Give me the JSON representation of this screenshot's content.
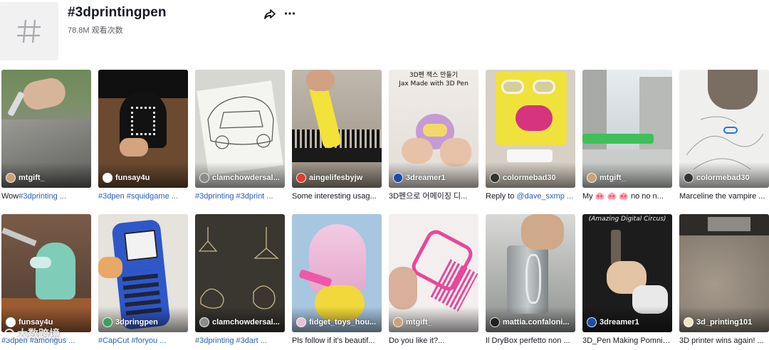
{
  "header": {
    "icon": "hashtag-icon",
    "title": "#3dprintingpen",
    "views": "78.8M 观看次数",
    "share_icon": "share-arrow-icon",
    "more_icon": "more-dots-icon"
  },
  "videos": [
    {
      "author": "mtgift_",
      "caption_plain": "Wow",
      "caption_tags": "#3dprinting ...",
      "avatar_color": "#c9a27a"
    },
    {
      "author": "funsay4u",
      "caption_plain": "",
      "caption_tags": "#3dpen #squidgame ...",
      "avatar_color": "#ffffff"
    },
    {
      "author": "clamchowdersal...",
      "caption_plain": "",
      "caption_tags": "#3dprinting #3dprint ...",
      "avatar_color": "#8c8c8c"
    },
    {
      "author": "aingelifesbyjw",
      "caption_plain": "Some interesting usag...",
      "caption_tags": "",
      "avatar_color": "#d8432e"
    },
    {
      "author": "3dreamer1",
      "caption_plain": "3D펜으로 어메이징 디...",
      "caption_tags": "",
      "avatar_color": "#1f4aa8",
      "overlay": [
        "3D펜 잭스 만들기",
        "Jax Made with 3D Pen"
      ]
    },
    {
      "author": "colormebad30",
      "caption_plain": "Reply to ",
      "caption_tags": "@dave_sxmp ...",
      "avatar_color": "#333333"
    },
    {
      "author": "mtgift_",
      "caption_plain": "My 🐽 🐽 🐽 no no n...",
      "caption_tags": "",
      "avatar_color": "#c9a27a"
    },
    {
      "author": "colormebad30",
      "caption_plain": "Marceline the vampire ...",
      "caption_tags": "",
      "avatar_color": "#333333"
    },
    {
      "author": "funsay4u",
      "caption_plain": "",
      "caption_tags": "#3dpen #amongus ...",
      "avatar_color": "#ffffff"
    },
    {
      "author": "3dpringpen",
      "caption_plain": "",
      "caption_tags": "#CapCut #foryou ...",
      "avatar_color": "#3aa15a"
    },
    {
      "author": "clamchowdersal...",
      "caption_plain": "",
      "caption_tags": "#3dprinting #3dart ...",
      "avatar_color": "#8c8c8c"
    },
    {
      "author": "fidget_toys_hou...",
      "caption_plain": "Pls follow if it's beautif...",
      "caption_tags": "",
      "avatar_color": "#e6c2d6"
    },
    {
      "author": "mtgift_",
      "caption_plain": "Do you like it?...",
      "caption_tags": "",
      "avatar_color": "#c9a27a"
    },
    {
      "author": "mattia.confaloni...",
      "caption_plain": "Il DryBox perfetto non ...",
      "caption_tags": "",
      "avatar_color": "#222222"
    },
    {
      "author": "3dreamer1",
      "caption_plain": "3D_Pen Making Pomni ...",
      "caption_tags": "",
      "avatar_color": "#1f4aa8",
      "overlay": [
        "(Amazing Digital Circus)"
      ]
    },
    {
      "author": "3d_printing101",
      "caption_plain": "3D printer wins again! ...",
      "caption_tags": "",
      "avatar_color": "#f0e4c8"
    }
  ],
  "watermark": {
    "text": "大数跨境",
    "icon": "watermark-logo-icon"
  }
}
